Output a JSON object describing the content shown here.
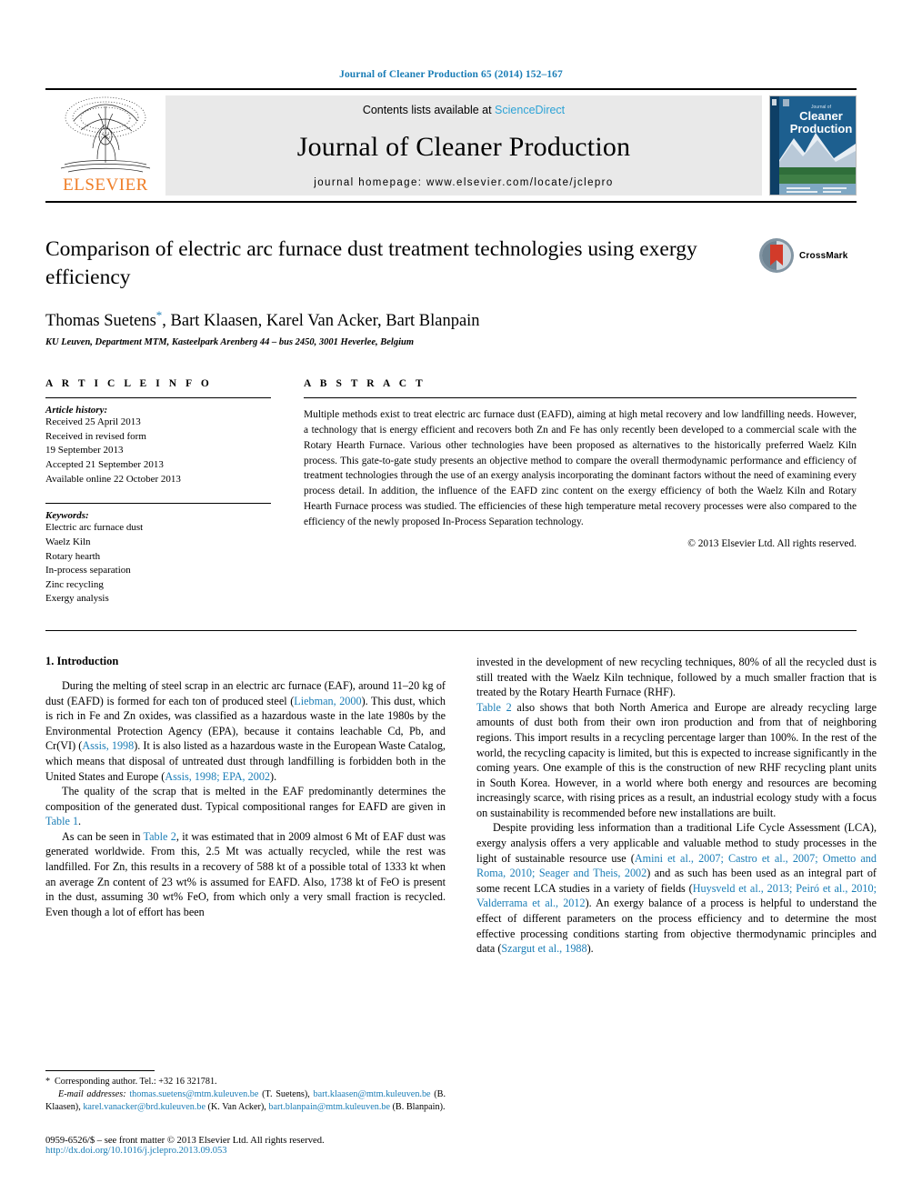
{
  "running_head": "Journal of Cleaner Production 65 (2014) 152–167",
  "masthead": {
    "contents_prefix": "Contents lists available at ",
    "sciencedirect": "ScienceDirect",
    "journal_title": "Journal of Cleaner Production",
    "homepage": "journal homepage: www.elsevier.com/locate/jclepro",
    "publisher_wordmark": "ELSEVIER",
    "cover_line1": "Journal of",
    "cover_line2": "Cleaner",
    "cover_line3": "Production",
    "logo_icon": "elsevier-tree-icon",
    "cover_icon": "journal-cover-thumbnail"
  },
  "article": {
    "title": "Comparison of electric arc furnace dust treatment technologies using exergy efficiency",
    "authors": "Thomas Suetens, Bart Klaasen, Karel Van Acker, Bart Blanpain",
    "author_star": "*",
    "affiliation": "KU Leuven, Department MTM, Kasteelpark Arenberg 44 – bus 2450, 3001 Heverlee, Belgium",
    "crossmark_label": "CrossMark",
    "crossmark_icon": "crossmark-badge-icon"
  },
  "article_info": {
    "heading": "A R T I C L E   I N F O",
    "history_label": "Article history:",
    "history": [
      "Received 25 April 2013",
      "Received in revised form",
      "19 September 2013",
      "Accepted 21 September 2013",
      "Available online 22 October 2013"
    ],
    "keywords_label": "Keywords:",
    "keywords": [
      "Electric arc furnace dust",
      "Waelz Kiln",
      "Rotary hearth",
      "In-process separation",
      "Zinc recycling",
      "Exergy analysis"
    ]
  },
  "abstract": {
    "heading": "A B S T R A C T",
    "text": "Multiple methods exist to treat electric arc furnace dust (EAFD), aiming at high metal recovery and low landfilling needs. However, a technology that is energy efficient and recovers both Zn and Fe has only recently been developed to a commercial scale with the Rotary Hearth Furnace. Various other technologies have been proposed as alternatives to the historically preferred Waelz Kiln process. This gate-to-gate study presents an objective method to compare the overall thermodynamic performance and efficiency of treatment technologies through the use of an exergy analysis incorporating the dominant factors without the need of examining every process detail. In addition, the influence of the EAFD zinc content on the exergy efficiency of both the Waelz Kiln and Rotary Hearth Furnace process was studied. The efficiencies of these high temperature metal recovery processes were also compared to the efficiency of the newly proposed In-Process Separation technology.",
    "copyright": "© 2013 Elsevier Ltd. All rights reserved."
  },
  "section": {
    "number_title": "1.  Introduction"
  },
  "left_column": {
    "p1_a": "During the melting of steel scrap in an electric arc furnace (EAF), around 11–20 kg of dust (EAFD) is formed for each ton of produced steel (",
    "p1_cite1": "Liebman, 2000",
    "p1_b": "). This dust, which is rich in Fe and Zn oxides, was classified as a hazardous waste in the late 1980s by the Environmental Protection Agency (EPA), because it contains leachable Cd, Pb, and Cr(VI) (",
    "p1_cite2": "Assis, 1998",
    "p1_c": "). It is also listed as a hazardous waste in the European Waste Catalog, which means that disposal of untreated dust through landfilling is forbidden both in the United States and Europe (",
    "p1_cite3": "Assis, 1998; EPA, 2002",
    "p1_d": ").",
    "p2_a": "The quality of the scrap that is melted in the EAF predominantly determines the composition of the generated dust. Typical compositional ranges for EAFD are given in ",
    "p2_cite1": "Table 1",
    "p2_b": ".",
    "p3_a": "As can be seen in ",
    "p3_cite1": "Table 2",
    "p3_b": ", it was estimated that in 2009 almost 6 Mt of EAF dust was generated worldwide. From this, 2.5 Mt was actually recycled, while the rest was landfilled. For Zn, this results in a recovery of 588 kt of a possible total of 1333 kt when an average Zn content of 23 wt% is assumed for EAFD. Also, 1738 kt of FeO is present in the dust, assuming 30 wt% FeO, from which only a very small fraction is recycled. Even though a lot of effort has been"
  },
  "right_column": {
    "p1": "invested in the development of new recycling techniques, 80% of all the recycled dust is still treated with the Waelz Kiln technique, followed by a much smaller fraction that is treated by the Rotary Hearth Furnace (RHF).",
    "p2_cite1": "Table 2",
    "p2_a": " also shows that both North America and Europe are already recycling large amounts of dust both from their own iron production and from that of neighboring regions. This import results in a recycling percentage larger than 100%. In the rest of the world, the recycling capacity is limited, but this is expected to increase significantly in the coming years. One example of this is the construction of new RHF recycling plant units in South Korea. However, in a world where both energy and resources are becoming increasingly scarce, with rising prices as a result, an industrial ecology study with a focus on sustainability is recommended before new installations are built.",
    "p3_a": "Despite providing less information than a traditional Life Cycle Assessment (LCA), exergy analysis offers a very applicable and valuable method to study processes in the light of sustainable resource use (",
    "p3_cite1": "Amini et al., 2007; Castro et al., 2007; Ometto and Roma, 2010; Seager and Theis, 2002",
    "p3_b": ") and as such has been used as an integral part of some recent LCA studies in a variety of fields (",
    "p3_cite2": "Huysveld et al., 2013; Peiró et al., 2010; Valderrama et al., 2012",
    "p3_c": "). An exergy balance of a process is helpful to understand the effect of different parameters on the process efficiency and to determine the most effective processing conditions starting from objective thermodynamic principles and data (",
    "p3_cite3": "Szargut et al., 1988",
    "p3_d": ")."
  },
  "footnotes": {
    "corresponding_marker": "*",
    "corresponding": "Corresponding author. Tel.: +32 16 321781.",
    "email_label": "E-mail addresses:",
    "emails": [
      {
        "address": "thomas.suetens@mtm.kuleuven.be",
        "name": " (T. Suetens), "
      },
      {
        "address": "bart.klaasen@mtm.kuleuven.be",
        "name": " (B. Klaasen), "
      },
      {
        "address": "karel.vanacker@brd.kuleuven.be",
        "name": " (K. Van Acker), "
      },
      {
        "address": "bart.blanpain@mtm.kuleuven.be",
        "name": " (B. Blanpain)."
      }
    ]
  },
  "footer": {
    "issn_line": "0959-6526/$ – see front matter © 2013 Elsevier Ltd. All rights reserved.",
    "doi": "http://dx.doi.org/10.1016/j.jclepro.2013.09.053"
  },
  "colors": {
    "link_blue": "#1a7db6",
    "elsevier_orange": "#ef7d26",
    "masthead_grey": "#e9e9e9"
  }
}
